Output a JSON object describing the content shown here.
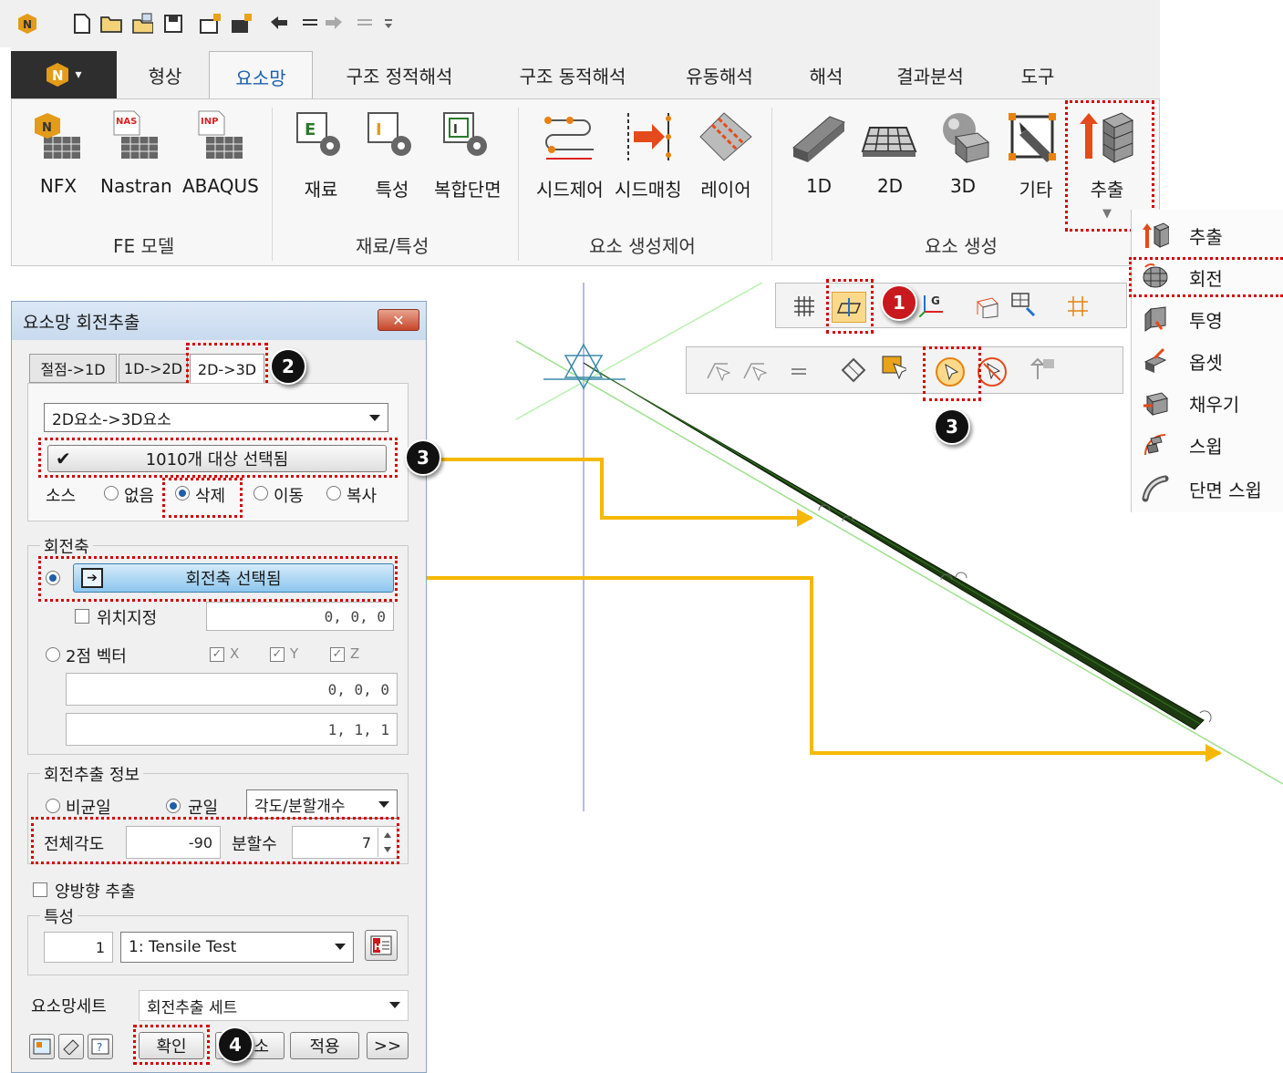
{
  "quick_access": {
    "icons": [
      "app-logo-icon",
      "new-file-icon",
      "open-folder-icon",
      "import-icon",
      "save-icon",
      "open-model-icon",
      "open-model2-icon",
      "undo-icon",
      "undo-list-icon",
      "redo-icon",
      "redo-list-icon",
      "customize-icon"
    ]
  },
  "ribbon": {
    "app_menu_arrow": "▾",
    "tabs": [
      "형상",
      "요소망",
      "구조 정적해석",
      "구조 동적해석",
      "유동해석",
      "해석",
      "결과분석",
      "도구"
    ],
    "active_tab": "요소망",
    "groups": [
      {
        "label": "FE 모델",
        "buttons": [
          "NFX",
          "Nastran",
          "ABAQUS"
        ]
      },
      {
        "label": "재료/특성",
        "buttons": [
          "재료",
          "특성",
          "복합단면"
        ]
      },
      {
        "label": "요소 생성제어",
        "buttons": [
          "시드제어",
          "시드매칭",
          "레이어"
        ]
      },
      {
        "label": "요소 생성",
        "buttons": [
          "1D",
          "2D",
          "3D",
          "기타",
          "추출"
        ]
      }
    ],
    "extrude_dropdown_arrow": "▼"
  },
  "popup_menu": {
    "items": [
      "추출",
      "회전",
      "투영",
      "옵셋",
      "채우기",
      "스윕",
      "단면 스윕"
    ]
  },
  "dialog": {
    "title": "요소망 회전추출",
    "close_label": "✕",
    "tabs": [
      "절점->1D",
      "1D->2D",
      "2D->3D"
    ],
    "type_combo": "2D요소->3D요소",
    "selected_targets": "1010개 대상 선택됨",
    "source_label": "소스",
    "source_options": [
      "없음",
      "삭제",
      "이동",
      "복사"
    ],
    "rotation_axis": {
      "legend": "회전축",
      "button": "회전축 선택됨",
      "position_label": "위치지정",
      "position_value": "0, 0, 0",
      "two_point_label": "2점 벡터",
      "axes": [
        "X",
        "Y",
        "Z"
      ],
      "point1": "0, 0, 0",
      "point2": "1, 1, 1"
    },
    "rotation_info": {
      "legend": "회전추출 정보",
      "non_uniform": "비균일",
      "uniform": "균일",
      "method_combo": "각도/분할개수",
      "total_angle_label": "전체각도",
      "total_angle": "-90",
      "divisions_label": "분할수",
      "divisions": "7"
    },
    "bidirectional_label": "양방향 추출",
    "property": {
      "legend": "특성",
      "id": "1",
      "combo": "1: Tensile Test"
    },
    "mesh_set_label": "요소망세트",
    "mesh_set_combo": "회전추출 세트",
    "buttons": {
      "ok": "확인",
      "cancel": "소",
      "apply": "적용",
      "more": ">>"
    }
  },
  "viewport_toolbar_top": {
    "icons": [
      "grid-icon",
      "work-plane-icon",
      "gcs-icon",
      "mesh-extrude-icon",
      "snap-icon",
      "snap-grid-icon"
    ]
  },
  "viewport_toolbar_select": {
    "icons": [
      "select-node-icon",
      "select-element-icon",
      "select-all-icon",
      "select-filter-icon",
      "select-box-icon",
      "pick-on-icon",
      "pick-off-icon",
      "pick-1d-icon"
    ]
  },
  "badges": [
    "1",
    "2",
    "3",
    "3",
    "4"
  ],
  "colors": {
    "highlight": "#d40000",
    "arrow": "#f5b800",
    "mesh": "#1e3a12",
    "accent": "#1c5fb0"
  }
}
